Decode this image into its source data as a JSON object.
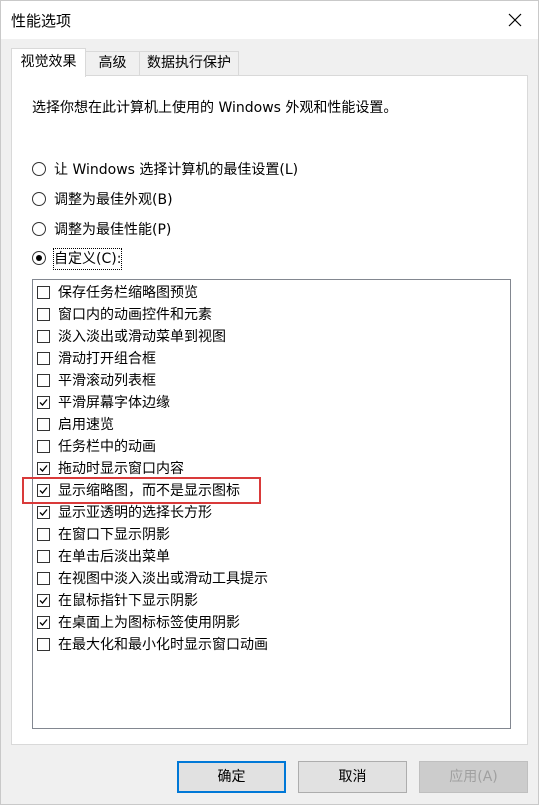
{
  "window": {
    "title": "性能选项"
  },
  "tabs": [
    {
      "label": "视觉效果",
      "active": true
    },
    {
      "label": "高级",
      "active": false
    },
    {
      "label": "数据执行保护",
      "active": false
    }
  ],
  "description": "选择你想在此计算机上使用的 Windows 外观和性能设置。",
  "radio_options": [
    {
      "label": "让 Windows 选择计算机的最佳设置(L)",
      "checked": false
    },
    {
      "label": "调整为最佳外观(B)",
      "checked": false
    },
    {
      "label": "调整为最佳性能(P)",
      "checked": false
    },
    {
      "label": "自定义(C):",
      "checked": true
    }
  ],
  "effects": [
    {
      "label": "保存任务栏缩略图预览",
      "checked": false
    },
    {
      "label": "窗口内的动画控件和元素",
      "checked": false
    },
    {
      "label": "淡入淡出或滑动菜单到视图",
      "checked": false
    },
    {
      "label": "滑动打开组合框",
      "checked": false
    },
    {
      "label": "平滑滚动列表框",
      "checked": false
    },
    {
      "label": "平滑屏幕字体边缘",
      "checked": true
    },
    {
      "label": "启用速览",
      "checked": false
    },
    {
      "label": "任务栏中的动画",
      "checked": false
    },
    {
      "label": "拖动时显示窗口内容",
      "checked": true
    },
    {
      "label": "显示缩略图，而不是显示图标",
      "checked": true
    },
    {
      "label": "显示亚透明的选择长方形",
      "checked": true
    },
    {
      "label": "在窗口下显示阴影",
      "checked": false
    },
    {
      "label": "在单击后淡出菜单",
      "checked": false
    },
    {
      "label": "在视图中淡入淡出或滑动工具提示",
      "checked": false
    },
    {
      "label": "在鼠标指针下显示阴影",
      "checked": true
    },
    {
      "label": "在桌面上为图标标签使用阴影",
      "checked": true
    },
    {
      "label": "在最大化和最小化时显示窗口动画",
      "checked": false
    }
  ],
  "buttons": {
    "ok": "确定",
    "cancel": "取消",
    "apply": "应用(A)"
  },
  "colors": {
    "highlight_border": "#d93a3a",
    "default_button_border": "#0078d7"
  }
}
